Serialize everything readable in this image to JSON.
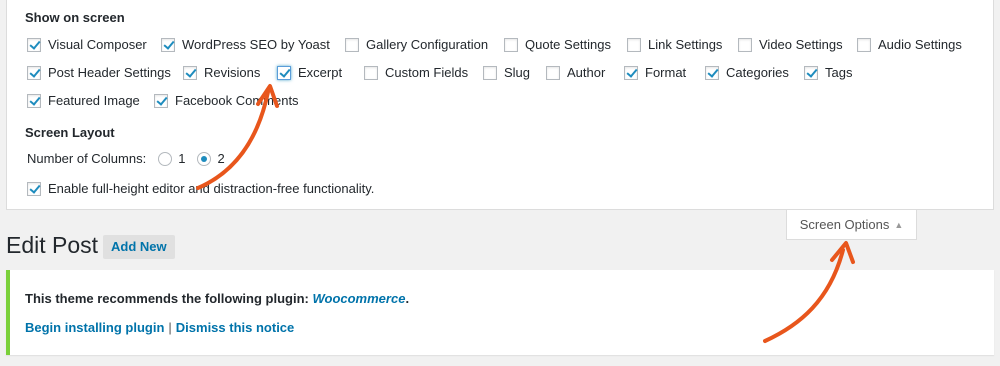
{
  "screen_options": {
    "heading": "Show on screen",
    "rows": [
      [
        {
          "label": "Visual Composer",
          "checked": true
        },
        {
          "label": "WordPress SEO by Yoast",
          "checked": true
        },
        {
          "label": "Gallery Configuration",
          "checked": false
        },
        {
          "label": "Quote Settings",
          "checked": false
        },
        {
          "label": "Link Settings",
          "checked": false
        },
        {
          "label": "Video Settings",
          "checked": false
        },
        {
          "label": "Audio Settings",
          "checked": false
        }
      ],
      [
        {
          "label": "Post Header Settings",
          "checked": true
        },
        {
          "label": "Revisions",
          "checked": true
        },
        {
          "label": "Excerpt",
          "checked": true
        },
        {
          "label": "Custom Fields",
          "checked": false
        },
        {
          "label": "Slug",
          "checked": false
        },
        {
          "label": "Author",
          "checked": false
        },
        {
          "label": "Format",
          "checked": true
        },
        {
          "label": "Categories",
          "checked": true
        },
        {
          "label": "Tags",
          "checked": true
        }
      ],
      [
        {
          "label": "Featured Image",
          "checked": true
        },
        {
          "label": "Facebook Comments",
          "checked": true
        }
      ]
    ],
    "layout_heading": "Screen Layout",
    "columns_label": "Number of Columns:",
    "column_options": [
      "1",
      "2"
    ],
    "selected_columns": "2",
    "editor_option": {
      "label": "Enable full-height editor and distraction-free functionality.",
      "checked": true
    }
  },
  "screen_options_tab": {
    "label": "Screen Options",
    "icon": "triangle-up-icon"
  },
  "page": {
    "title": "Edit Post",
    "add_new": "Add New"
  },
  "notice": {
    "text": "This theme recommends the following plugin: ",
    "plugin": "Woocommerce",
    "suffix": ".",
    "install_link": "Begin installing plugin",
    "separator": "|",
    "dismiss_link": "Dismiss this notice",
    "border_color": "#7ad03a"
  },
  "annotation_color": "#e8561c"
}
